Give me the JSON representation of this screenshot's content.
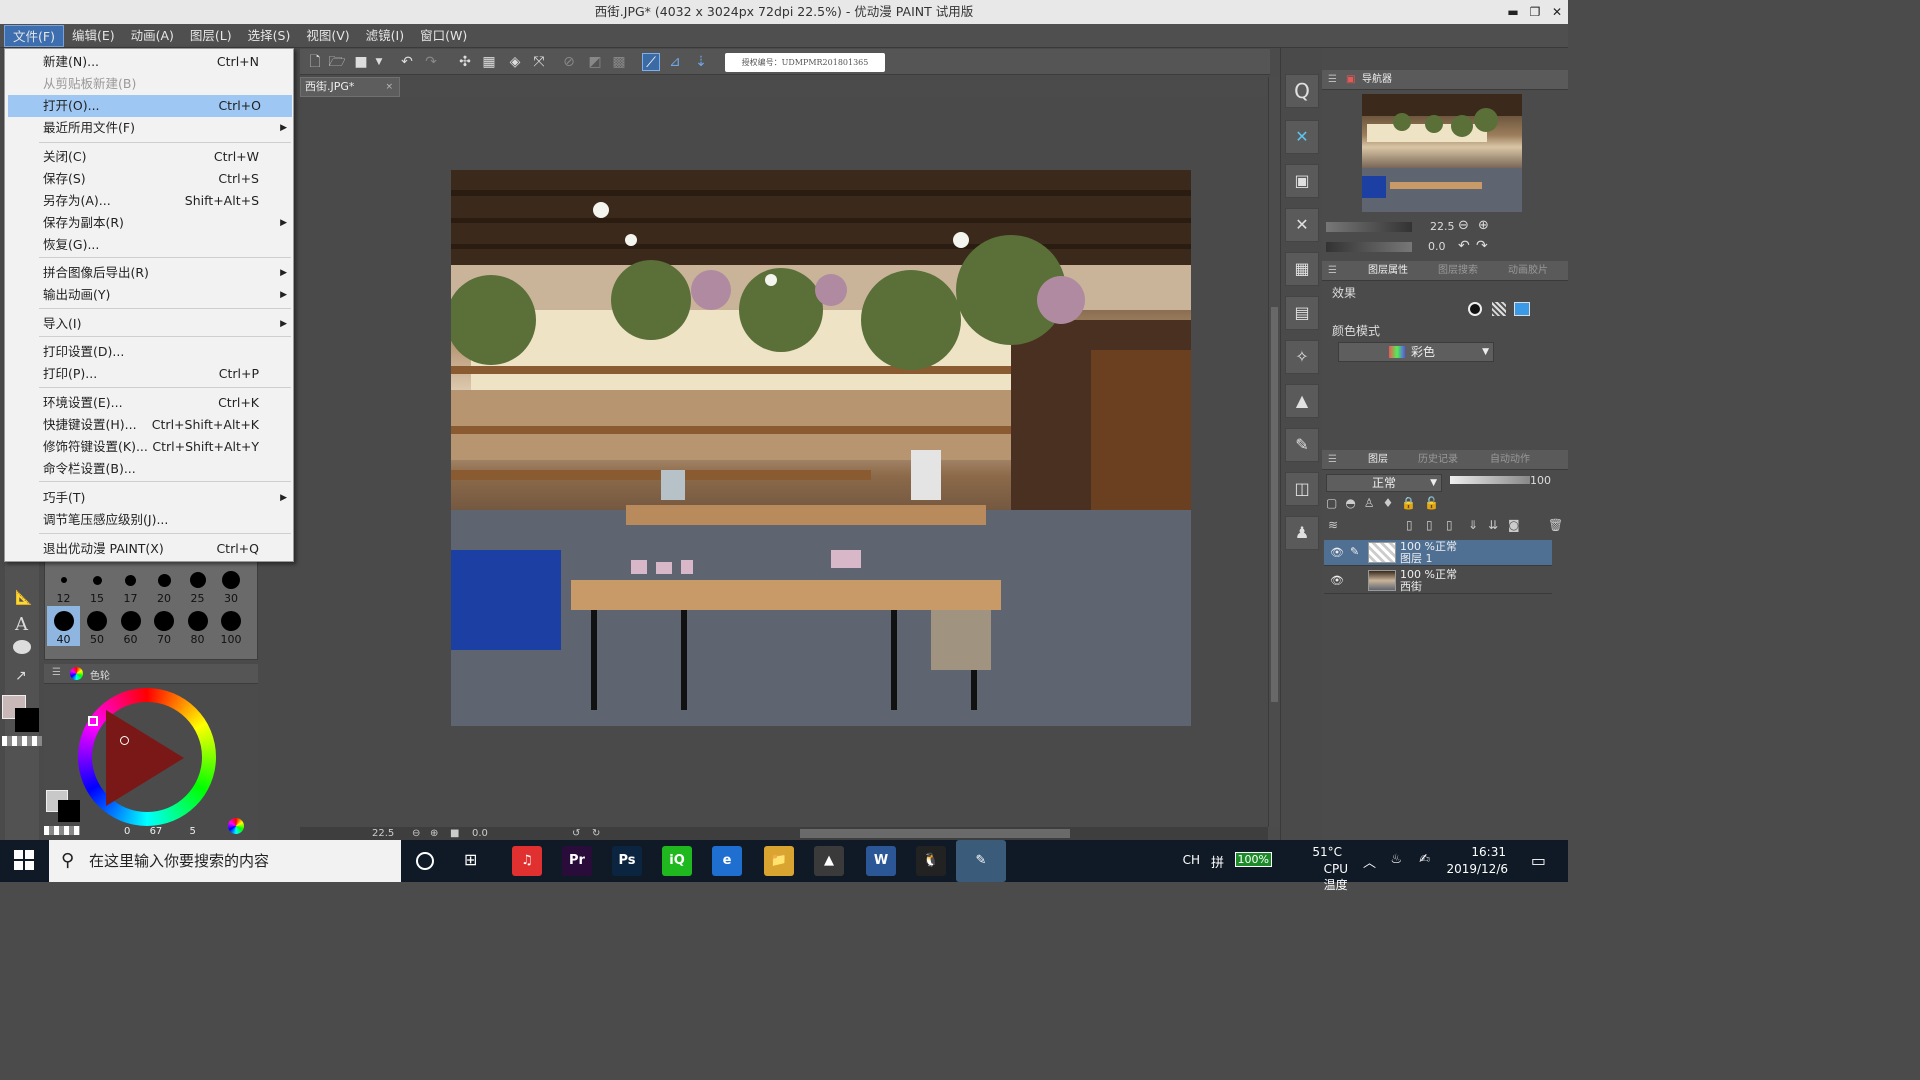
{
  "window": {
    "title": "西街.JPG* (4032 x 3024px 72dpi 22.5%) - 优动漫 PAINT 试用版",
    "min": "▬",
    "max": "❐",
    "close": "✕"
  },
  "menubar": [
    {
      "label": "文件(F)",
      "active": true
    },
    {
      "label": "编辑(E)"
    },
    {
      "label": "动画(A)"
    },
    {
      "label": "图层(L)"
    },
    {
      "label": "选择(S)"
    },
    {
      "label": "视图(V)"
    },
    {
      "label": "滤镜(I)"
    },
    {
      "label": "窗口(W)"
    }
  ],
  "file_menu": [
    {
      "label": "新建(N)...",
      "shortcut": "Ctrl+N"
    },
    {
      "label": "从剪贴板新建(B)",
      "shortcut": "",
      "disabled": true
    },
    {
      "label": "打开(O)...",
      "shortcut": "Ctrl+O",
      "highlighted": true
    },
    {
      "label": "最近所用文件(F)",
      "shortcut": "",
      "submenu": true
    },
    {
      "label": "关闭(C)",
      "shortcut": "Ctrl+W"
    },
    {
      "label": "保存(S)",
      "shortcut": "Ctrl+S"
    },
    {
      "label": "另存为(A)...",
      "shortcut": "Shift+Alt+S"
    },
    {
      "label": "保存为副本(R)",
      "shortcut": "",
      "submenu": true
    },
    {
      "label": "恢复(G)...",
      "shortcut": ""
    },
    {
      "label": "拼合图像后导出(R)",
      "shortcut": "",
      "submenu": true
    },
    {
      "label": "输出动画(Y)",
      "shortcut": "",
      "submenu": true
    },
    {
      "label": "导入(I)",
      "shortcut": "",
      "submenu": true
    },
    {
      "label": "打印设置(D)...",
      "shortcut": ""
    },
    {
      "label": "打印(P)...",
      "shortcut": "Ctrl+P"
    },
    {
      "label": "环境设置(E)...",
      "shortcut": "Ctrl+K"
    },
    {
      "label": "快捷键设置(H)...",
      "shortcut": "Ctrl+Shift+Alt+K"
    },
    {
      "label": "修饰符键设置(K)...",
      "shortcut": "Ctrl+Shift+Alt+Y"
    },
    {
      "label": "命令栏设置(B)...",
      "shortcut": ""
    },
    {
      "label": "巧手(T)",
      "shortcut": "",
      "submenu": true
    },
    {
      "label": "调节笔压感应级别(J)...",
      "shortcut": ""
    },
    {
      "label": "退出优动漫 PAINT(X)",
      "shortcut": "Ctrl+Q"
    }
  ],
  "toolbar": {
    "license_text": "授权编号：UDMPMR201801365",
    "icons": [
      "new-file-icon",
      "open-file-icon",
      "save-icon",
      "dropdown-icon",
      "undo-icon",
      "redo-icon",
      "clear-icon",
      "fill-icon",
      "transform-icon",
      "scale-icon",
      "deselect-icon",
      "invert-icon",
      "show-selection-icon",
      "snap-ruler-icon",
      "snap-special-ruler-icon",
      "snap-grid-icon"
    ]
  },
  "document_tab": {
    "label": "西街.JPG*",
    "close": "×"
  },
  "status_bar": {
    "zoom": "22.5",
    "rotation": "0.0"
  },
  "brush_sizes": [
    {
      "size": "12",
      "d": 6
    },
    {
      "size": "15",
      "d": 9
    },
    {
      "size": "17",
      "d": 11
    },
    {
      "size": "20",
      "d": 13
    },
    {
      "size": "25",
      "d": 16
    },
    {
      "size": "30",
      "d": 18
    },
    {
      "size": "40",
      "d": 20
    },
    {
      "size": "50",
      "d": 20
    },
    {
      "size": "60",
      "d": 20
    },
    {
      "size": "70",
      "d": 20
    },
    {
      "size": "80",
      "d": 20
    },
    {
      "size": "100",
      "d": 20
    }
  ],
  "color_panel": {
    "tab_label": "色轮",
    "readout": {
      "h": "0",
      "s": "67",
      "v": "5"
    }
  },
  "navigator": {
    "tab_label": "导航器",
    "zoom": "22.5",
    "rotation": "0.0"
  },
  "layer_property": {
    "tabs": [
      "图层属性",
      "图层搜索",
      "动画胶片"
    ],
    "effect_label": "效果",
    "color_mode_label": "颜色模式",
    "color_mode_value": "彩色"
  },
  "layers_panel": {
    "tabs": [
      "图层",
      "历史记录",
      "自动动作"
    ],
    "blend_mode": "正常",
    "opacity": "100",
    "layers": [
      {
        "line1": "100 %正常",
        "line2": "图层 1",
        "selected": true
      },
      {
        "line1": "100 %正常",
        "line2": "西街",
        "selected": false
      }
    ]
  },
  "taskbar": {
    "search_placeholder": "在这里输入你要搜索的内容",
    "apps": [
      {
        "name": "netease-music-icon",
        "label": "♫",
        "color": "#e03030"
      },
      {
        "name": "premiere-icon",
        "label": "Pr",
        "color": "#2a0c3a"
      },
      {
        "name": "photoshop-icon",
        "label": "Ps",
        "color": "#0b2540"
      },
      {
        "name": "iqiyi-icon",
        "label": "iQ",
        "color": "#1fb81f"
      },
      {
        "name": "edge-icon",
        "label": "e",
        "color": "#1f6fd0"
      },
      {
        "name": "explorer-icon",
        "label": "📁",
        "color": "#d9a430"
      },
      {
        "name": "photos-icon",
        "label": "▲",
        "color": "#3a3a3a"
      },
      {
        "name": "word-icon",
        "label": "W",
        "color": "#2b5797"
      },
      {
        "name": "qq-icon",
        "label": "🐧",
        "color": "#222"
      },
      {
        "name": "paint-app-icon",
        "label": "✎",
        "color": "#5da4d6"
      }
    ],
    "tray": {
      "ime": "CH",
      "ime2": "拼",
      "battery": "100%",
      "temp": "51°C",
      "temp_label": "CPU温度",
      "time": "16:31",
      "date": "2019/12/6"
    }
  }
}
